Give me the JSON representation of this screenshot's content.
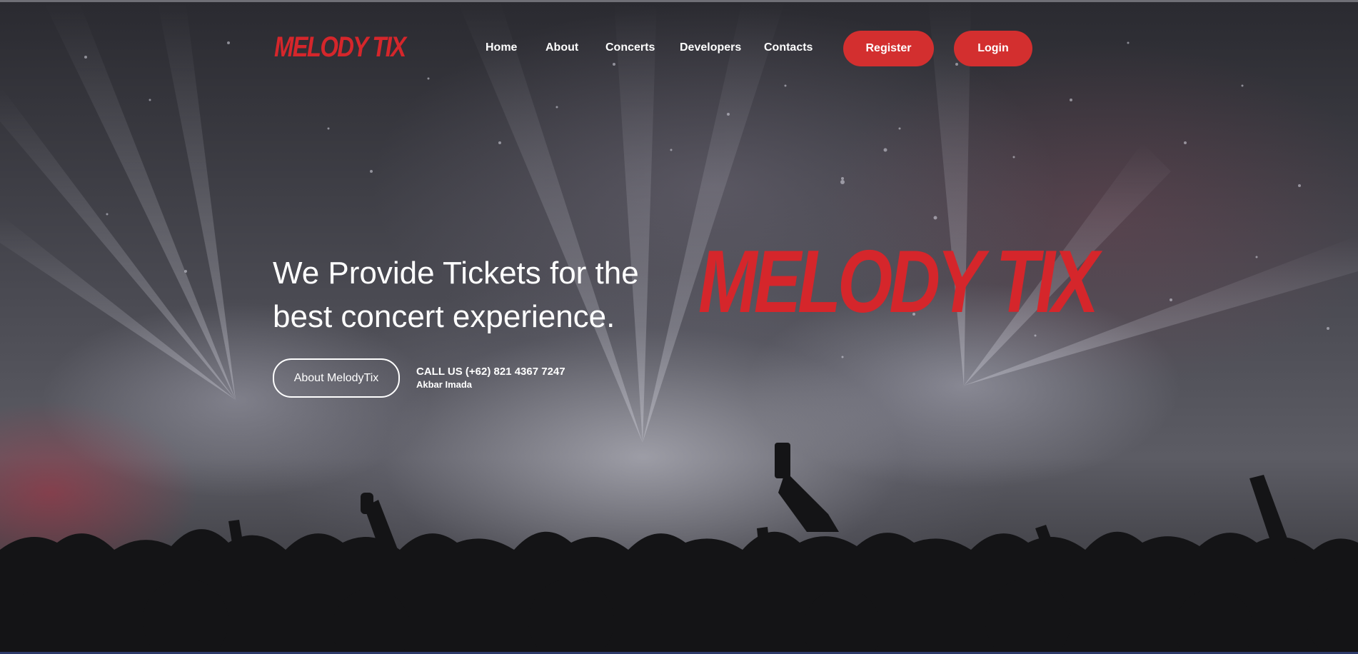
{
  "brand": {
    "logo_text": "MELODY TIX",
    "accent_color": "#d5262b",
    "button_color": "#d32f2f"
  },
  "nav": {
    "items": [
      {
        "label": "Home"
      },
      {
        "label": "About"
      },
      {
        "label": "Concerts"
      },
      {
        "label": "Developers"
      },
      {
        "label": "Contacts"
      }
    ],
    "register_label": "Register",
    "login_label": "Login"
  },
  "hero": {
    "headline_line1": "We Provide Tickets for the",
    "headline_line2": "best concert experience.",
    "big_logo_text": "MELODY TIX",
    "about_button_label": "About MelodyTix",
    "call_text": "CALL US (+62) 821 4367 7247",
    "contact_name": "Akbar Imada",
    "background_image": "concert-crowd-photo"
  }
}
